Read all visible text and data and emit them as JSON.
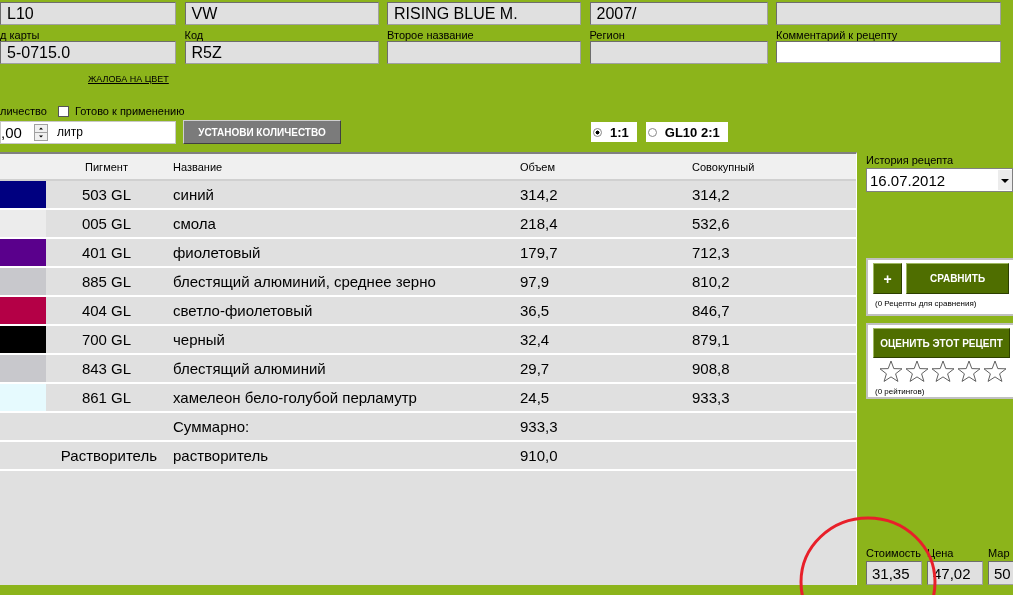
{
  "header_fields": [
    {
      "value": "L10",
      "kind": "readonly"
    },
    {
      "value": "VW",
      "kind": "readonly"
    },
    {
      "value": "RISING BLUE M.",
      "kind": "readonly"
    },
    {
      "value": "2007/",
      "kind": "readonly"
    },
    {
      "kind": "readonly"
    }
  ],
  "detail_fields": [
    {
      "label": "д карты",
      "value": "5-0715.0",
      "kind": "readonly"
    },
    {
      "label": "Код",
      "value": "R5Z",
      "kind": "readonly"
    },
    {
      "label": "Второе название",
      "kind": "readonly"
    },
    {
      "label": "Регион",
      "kind": "readonly"
    },
    {
      "label": "Комментарий к рецепту",
      "kind": "editable"
    }
  ],
  "complaint_link": "ЖАЛОБА НА ЦВЕТ",
  "quantity": {
    "label": "личество",
    "value": ",00",
    "unit": "литр",
    "button": "УСТАНОВИ КОЛИЧЕСТВО"
  },
  "ready_checkbox": {
    "label": "Готово к применению",
    "checked": false
  },
  "ratio_options": [
    {
      "label": "1:1",
      "selected": true
    },
    {
      "label": "GL10 2:1",
      "selected": false
    }
  ],
  "table": {
    "columns": [
      "Пигмент",
      "Название",
      "Объем",
      "Совокупный"
    ],
    "rows": [
      {
        "kind": "pigment",
        "color": "#000080",
        "pigment": "503 GL",
        "name": "синий",
        "volume": "314,2",
        "cumulative": "314,2"
      },
      {
        "kind": "pigment",
        "color": "#ececec",
        "pigment": "005 GL",
        "name": "смола",
        "volume": "218,4",
        "cumulative": "532,6"
      },
      {
        "kind": "pigment",
        "color": "#5a008c",
        "pigment": "401 GL",
        "name": "фиолетовый",
        "volume": "179,7",
        "cumulative": "712,3"
      },
      {
        "kind": "pigment",
        "color": "#c8c8cc",
        "pigment": "885 GL",
        "name": "блестящий алюминий, среднее зерно",
        "volume": "97,9",
        "cumulative": "810,2"
      },
      {
        "kind": "pigment",
        "color": "#b40046",
        "pigment": "404 GL",
        "name": "светло-фиолетовый",
        "volume": "36,5",
        "cumulative": "846,7"
      },
      {
        "kind": "pigment",
        "color": "#000000",
        "pigment": "700 GL",
        "name": "черный",
        "volume": "32,4",
        "cumulative": "879,1"
      },
      {
        "kind": "pigment",
        "color": "#c8c8cc",
        "pigment": "843 GL",
        "name": "блестящий алюминий",
        "volume": "29,7",
        "cumulative": "908,8"
      },
      {
        "kind": "pigment",
        "color": "#e6fafe",
        "pigment": "861 GL",
        "name": "хамелеон бело-голубой перламутр",
        "volume": "24,5",
        "cumulative": "933,3"
      },
      {
        "kind": "summary",
        "name": "Суммарно:",
        "volume": "933,3"
      },
      {
        "kind": "summary",
        "pigment": "Растворитель",
        "name": "растворитель",
        "volume": "910,0"
      }
    ]
  },
  "history": {
    "label": "История рецепта",
    "value": "16.07.2012"
  },
  "compare": {
    "add_button": "+",
    "button": "СРАВНИТЬ",
    "note": "(0 Рецепты для сравнения)"
  },
  "rating": {
    "button": "ОЦЕНИТЬ ЭТОТ РЕЦЕПТ",
    "stars": 0,
    "note": "(0 рейтингов)"
  },
  "totals": [
    {
      "label": "Стоимость",
      "value": "31,35"
    },
    {
      "label": "Цена",
      "value": "47,02"
    },
    {
      "label": "Мар",
      "value": "50"
    }
  ],
  "annotation": {
    "kind": "circle"
  }
}
